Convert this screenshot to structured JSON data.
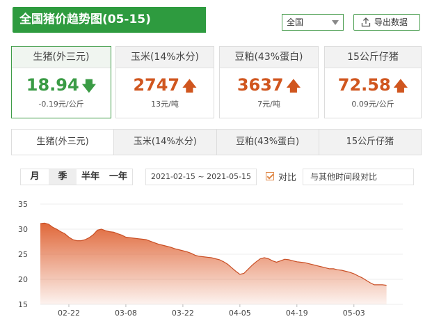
{
  "header": {
    "title": "全国猪价趋势图(05-15)",
    "region_selected": "全国",
    "export_label": "导出数据"
  },
  "cards": [
    {
      "name": "生猪(外三元)",
      "value": "18.94",
      "trend": "down",
      "arrow": "🡇",
      "change": "-0.19元/公斤"
    },
    {
      "name": "玉米(14%水分)",
      "value": "2747",
      "trend": "up",
      "arrow": "🡅",
      "change": "13元/吨"
    },
    {
      "name": "豆粕(43%蛋白)",
      "value": "3637",
      "trend": "up",
      "arrow": "🡅",
      "change": "7元/吨"
    },
    {
      "name": "15公斤仔猪",
      "value": "72.58",
      "trend": "up",
      "arrow": "🡅",
      "change": "0.09元/公斤"
    }
  ],
  "tabs": [
    "生猪(外三元)",
    "玉米(14%水分)",
    "豆粕(43%蛋白)",
    "15公斤仔猪"
  ],
  "periods": [
    "月",
    "季",
    "半年",
    "一年"
  ],
  "active_period": "季",
  "date_range": "2021-02-15 ~ 2021-05-15",
  "compare": {
    "label": "对比",
    "checked": true,
    "placeholder": "与其他时间段对比"
  },
  "colors": {
    "brand_green": "#2e9b3f",
    "up": "#d0561f",
    "down": "#3a9b45",
    "area_top": "#e0683a"
  },
  "chart_data": {
    "type": "area",
    "title": "",
    "xlabel": "",
    "ylabel": "",
    "ylim": [
      15,
      35
    ],
    "yticks": [
      15,
      20,
      25,
      30,
      35
    ],
    "x_tick_labels": [
      "02-22",
      "03-08",
      "03-22",
      "04-05",
      "04-19",
      "05-03"
    ],
    "x_tick_days": [
      7,
      21,
      35,
      49,
      63,
      77
    ],
    "x_range_days": [
      0,
      89
    ],
    "x": [
      0,
      1,
      2,
      3,
      4,
      5,
      6,
      7,
      8,
      9,
      10,
      11,
      12,
      13,
      14,
      15,
      16,
      17,
      18,
      19,
      20,
      21,
      22,
      23,
      24,
      25,
      26,
      27,
      28,
      29,
      30,
      31,
      32,
      33,
      34,
      35,
      36,
      37,
      38,
      39,
      40,
      41,
      42,
      43,
      44,
      45,
      46,
      47,
      48,
      49,
      50,
      51,
      52,
      53,
      54,
      55,
      56,
      57,
      58,
      59,
      60,
      61,
      62,
      63,
      64,
      65,
      66,
      67,
      68,
      69,
      70,
      71,
      72,
      73,
      74,
      75,
      76,
      77,
      78,
      79,
      80,
      81,
      82,
      83,
      84,
      85,
      86,
      87,
      88
    ],
    "series": [
      {
        "values": [
          31.1,
          31.2,
          31.0,
          30.4,
          30.0,
          29.5,
          29.1,
          28.4,
          27.9,
          27.7,
          27.7,
          27.9,
          28.3,
          28.9,
          29.8,
          30.0,
          29.7,
          29.5,
          29.4,
          29.1,
          28.8,
          28.4,
          28.3,
          28.2,
          28.1,
          28.0,
          27.9,
          27.6,
          27.3,
          27.0,
          26.8,
          26.6,
          26.4,
          26.1,
          25.9,
          25.7,
          25.5,
          25.2,
          24.8,
          24.6,
          24.5,
          24.4,
          24.3,
          24.1,
          23.9,
          23.5,
          23.0,
          22.3,
          21.6,
          21.0,
          21.2,
          22.0,
          22.8,
          23.5,
          24.1,
          24.3,
          24.1,
          23.7,
          23.4,
          23.7,
          24.0,
          23.9,
          23.7,
          23.5,
          23.4,
          23.3,
          23.1,
          22.9,
          22.7,
          22.5,
          22.3,
          22.1,
          22.1,
          21.9,
          21.8,
          21.6,
          21.4,
          21.1,
          20.7,
          20.3,
          19.8,
          19.3,
          18.9,
          18.9,
          18.9,
          18.8
        ]
      }
    ]
  }
}
